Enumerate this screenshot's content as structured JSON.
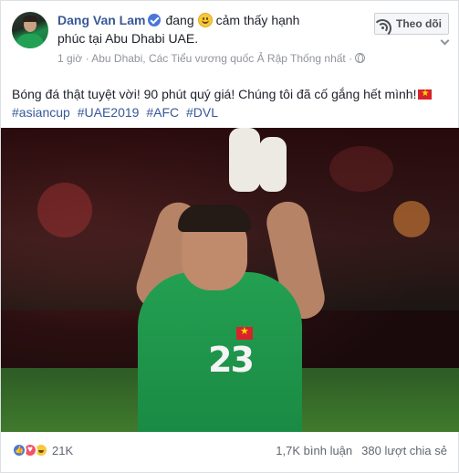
{
  "post": {
    "author": "Dang Van Lam",
    "feeling_word": "đang",
    "feeling": "cảm thấy hạnh",
    "feeling_line2": "phúc tại",
    "place": "Abu Dhabi UAE",
    "place_suffix": ".",
    "time": "1 giờ",
    "dot": "·",
    "location": "Abu Dhabi, Các Tiểu vương quốc Ả Rập Thống nhất",
    "location_dot": "·",
    "follow_label": "Theo dõi",
    "body": "Bóng đá thật tuyệt vời! 90 phút quý giá! Chúng tôi đã cố gắng hết mình!",
    "hashtags": [
      "#asiancup",
      "#UAE2019",
      "#AFC",
      "#DVL"
    ]
  },
  "photo": {
    "jersey_number": "23"
  },
  "footer": {
    "reactions_count": "21K",
    "comments": "1,7K bình luận",
    "shares": "380 lượt chia sẻ"
  },
  "colors": {
    "link": "#385898",
    "verified": "#4a76d9",
    "jersey": "#23a052"
  },
  "icons": [
    "verified-icon",
    "smile-icon",
    "globe-icon",
    "rss-icon",
    "chevron-down-icon",
    "vietnam-flag-icon",
    "like-reaction-icon",
    "love-reaction-icon",
    "haha-reaction-icon"
  ]
}
